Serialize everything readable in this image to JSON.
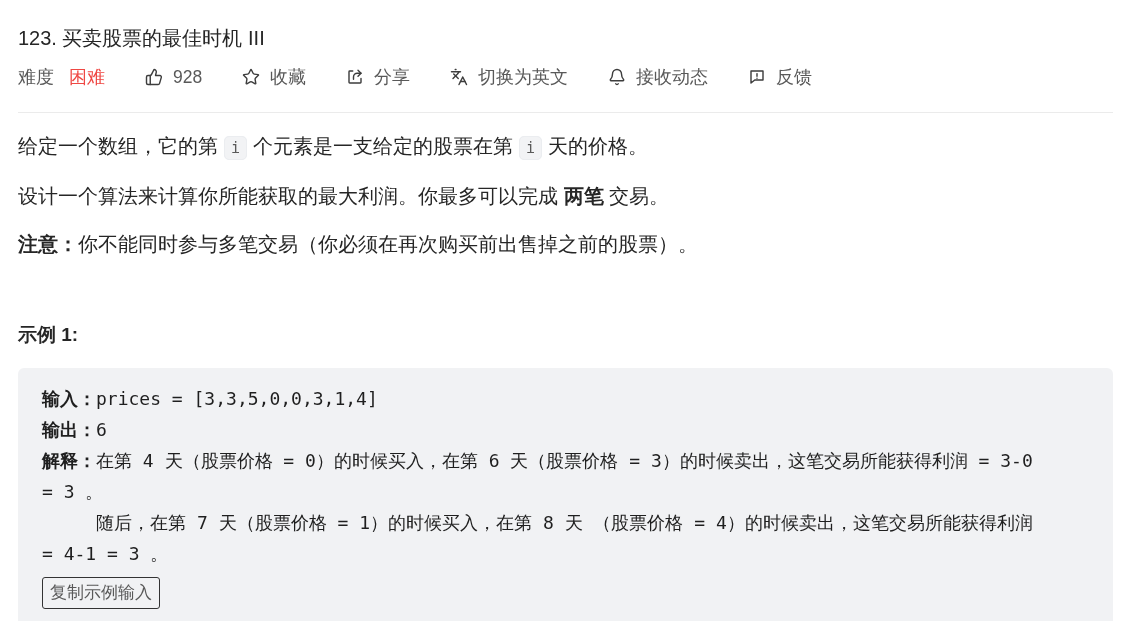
{
  "title": "123. 买卖股票的最佳时机 III",
  "meta": {
    "difficulty_label": "难度",
    "difficulty": "困难",
    "actions": [
      {
        "label": "928"
      },
      {
        "label": "收藏"
      },
      {
        "label": "分享"
      },
      {
        "label": "切换为英文"
      },
      {
        "label": "接收动态"
      },
      {
        "label": "反馈"
      }
    ]
  },
  "description": [
    {
      "kind": "segments",
      "segments": [
        {
          "kind": "text",
          "text": "给定一个数组，它的第"
        },
        {
          "kind": "code",
          "text": "i"
        },
        {
          "kind": "text",
          "text": "个元素是一支给定的股票在第"
        },
        {
          "kind": "code",
          "text": "i"
        },
        {
          "kind": "text",
          "text": "天的价格。"
        }
      ]
    },
    {
      "kind": "rich",
      "text": "设计一个算法来计算你所能获取的最大利润。你最多可以完成 **两笔** 交易。"
    },
    {
      "kind": "rich",
      "text": "**注意：**你不能同时参与多笔交易（你必须在再次购买前出售掉之前的股票）。"
    }
  ],
  "example": {
    "title": "示例 1:",
    "lines": [
      "**输入：**prices = [3,3,5,0,0,3,1,4]",
      "**输出：**6",
      "**解释：**在第 4 天（股票价格 = 0）的时候买入，在第 6 天（股票价格 = 3）的时候卖出，这笔交易所能获得利润 = 3-0 = 3 。",
      "     随后，在第 7 天（股票价格 = 1）的时候买入，在第 8 天 （股票价格 = 4）的时候卖出，这笔交易所能获得利润 = 4-1 = 3 。"
    ],
    "copy_button": "复制示例输入"
  }
}
